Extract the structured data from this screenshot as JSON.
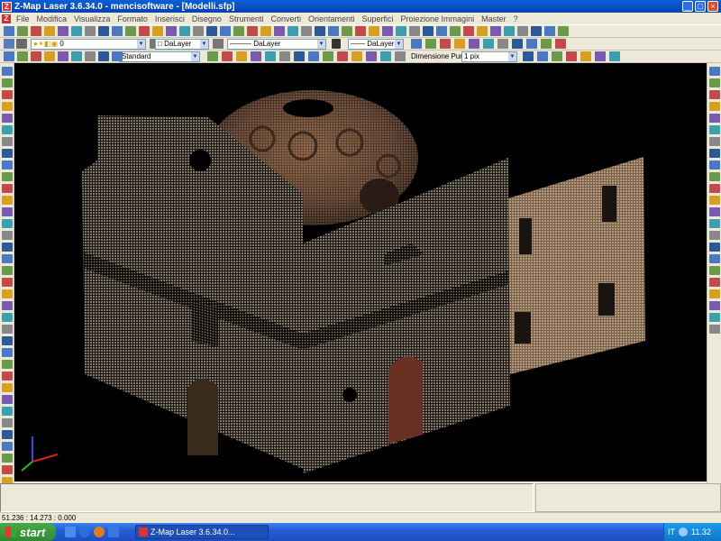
{
  "window": {
    "title": "Z-Map Laser 3.6.34.0 - mencisoftware - [Modelli.sfp]",
    "app_icon_letter": "Z"
  },
  "menu": [
    "File",
    "Modifica",
    "Visualizza",
    "Formato",
    "Inserisci",
    "Disegno",
    "Strumenti",
    "Converti",
    "Orientamenti",
    "Superfici",
    "Proiezione Immagini",
    "Master",
    "?"
  ],
  "toolbar2": {
    "layer_value": "0",
    "color_value": "DaLayer",
    "linetype_value": "DaLayer",
    "lineweight_value": "DaLayer"
  },
  "toolbar3": {
    "style_value": "Standard",
    "point_size_label": "Dimensione Punto:",
    "point_size_value": "1 pix"
  },
  "status": {
    "coordinates": "51.236 : 14.273 : 0.000"
  },
  "taskbar": {
    "start_label": "start",
    "task_item": "Z-Map Laser 3.6.34.0...",
    "language": "IT",
    "clock": "11.32"
  },
  "colors": {
    "titlebar": "#0842b0",
    "viewport": "#000000",
    "taskbar": "#245dd7",
    "start": "#2f8a2f"
  }
}
